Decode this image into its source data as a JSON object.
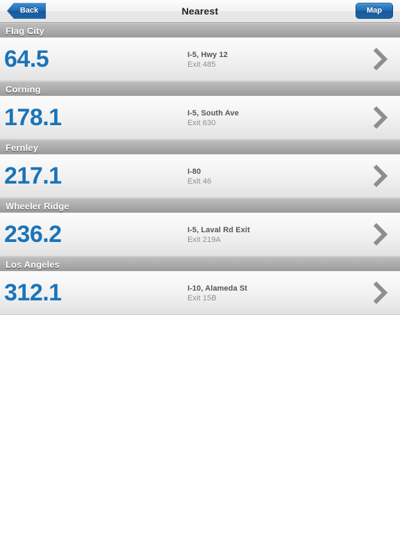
{
  "navbar": {
    "back_label": "Back",
    "title": "Nearest",
    "map_label": "Map"
  },
  "colors": {
    "accent_blue": "#1b74b8",
    "button_blue": "#1f6cb4",
    "section_header_gray": "#aeaeae",
    "chevron_gray": "#8e8e8e",
    "road_text": "#555555",
    "exit_text": "#8d8d8d"
  },
  "list": {
    "sections": [
      {
        "header": "Flag City",
        "row": {
          "distance": "64.5",
          "road": "I-5, Hwy 12",
          "exit": "Exit 485",
          "disclosure_icon": "chevron-right-icon"
        }
      },
      {
        "header": "Corning",
        "row": {
          "distance": "178.1",
          "road": "I-5, South Ave",
          "exit": "Exit 630",
          "disclosure_icon": "chevron-right-icon"
        }
      },
      {
        "header": "Fernley",
        "row": {
          "distance": "217.1",
          "road": "I-80",
          "exit": "Exit 46",
          "disclosure_icon": "chevron-right-icon"
        }
      },
      {
        "header": "Wheeler Ridge",
        "row": {
          "distance": "236.2",
          "road": "I-5, Laval Rd Exit",
          "exit": "Exit 219A",
          "disclosure_icon": "chevron-right-icon"
        }
      },
      {
        "header": "Los Angeles",
        "row": {
          "distance": "312.1",
          "road": "I-10, Alameda St",
          "exit": "Exit 15B",
          "disclosure_icon": "chevron-right-icon"
        }
      }
    ]
  }
}
